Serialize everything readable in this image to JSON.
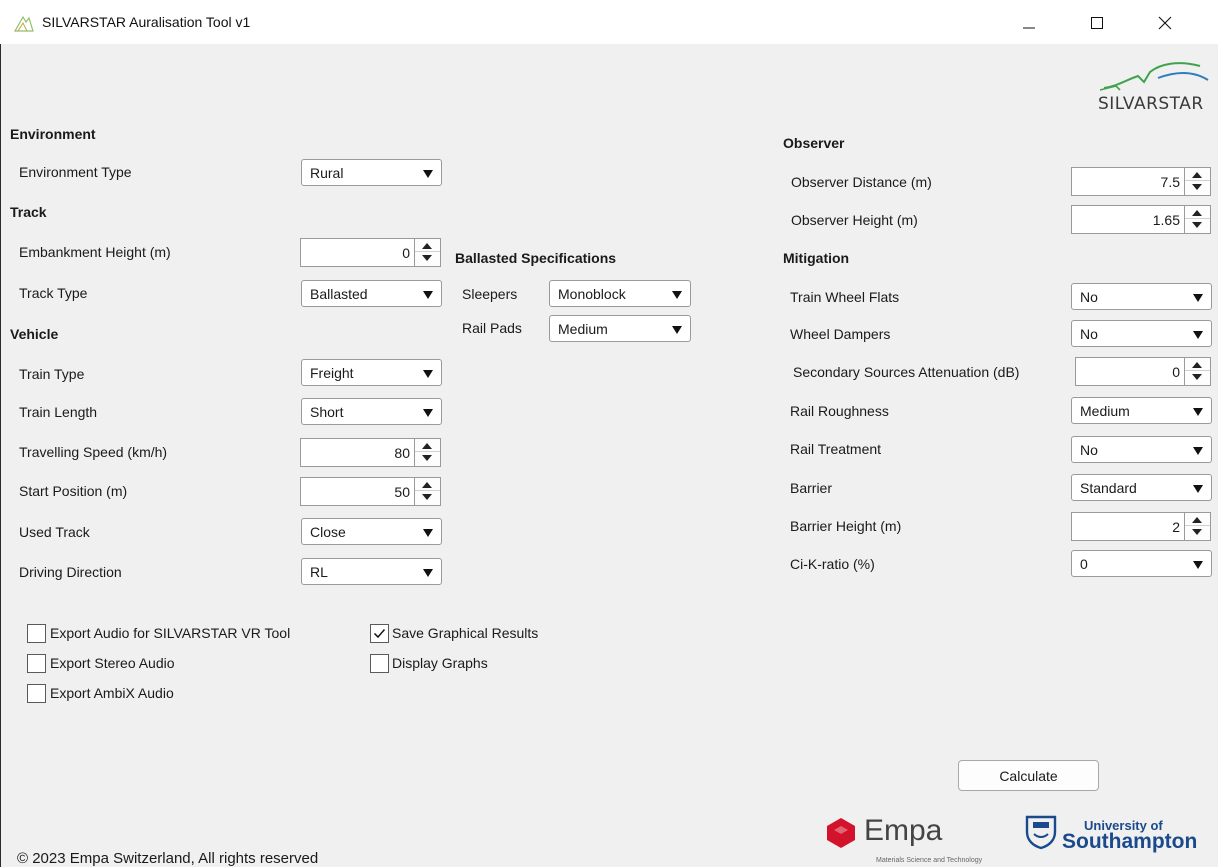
{
  "window": {
    "title": "SILVARSTAR Auralisation Tool v1",
    "minimize_icon": "minimize-icon",
    "maximize_icon": "maximize-icon",
    "close_icon": "close-icon"
  },
  "logos": {
    "silvarstar": "SILVARSTAR",
    "empa": "Empa",
    "empa_sub": "Materials Science and Technology",
    "southampton_top": "University of",
    "southampton_bottom": "Southampton"
  },
  "environment": {
    "heading": "Environment",
    "type_label": "Environment Type",
    "type_value": "Rural"
  },
  "track": {
    "heading": "Track",
    "embankment_label": "Embankment Height (m)",
    "embankment_value": "0",
    "type_label": "Track Type",
    "type_value": "Ballasted"
  },
  "ballasted": {
    "heading": "Ballasted Specifications",
    "sleepers_label": "Sleepers",
    "sleepers_value": "Monoblock",
    "railpads_label": "Rail Pads",
    "railpads_value": "Medium"
  },
  "vehicle": {
    "heading": "Vehicle",
    "train_type_label": "Train Type",
    "train_type_value": "Freight",
    "train_length_label": "Train Length",
    "train_length_value": "Short",
    "speed_label": "Travelling Speed (km/h)",
    "speed_value": "80",
    "start_label": "Start Position (m)",
    "start_value": "50",
    "used_track_label": "Used Track",
    "used_track_value": "Close",
    "direction_label": "Driving Direction",
    "direction_value": "RL"
  },
  "observer": {
    "heading": "Observer",
    "distance_label": "Observer Distance (m)",
    "distance_value": "7.5",
    "height_label": "Observer Height (m)",
    "height_value": "1.65"
  },
  "mitigation": {
    "heading": "Mitigation",
    "wheel_flats_label": "Train Wheel Flats",
    "wheel_flats_value": "No",
    "wheel_dampers_label": "Wheel Dampers",
    "wheel_dampers_value": "No",
    "secondary_label": "Secondary Sources Attenuation (dB)",
    "secondary_value": "0",
    "roughness_label": "Rail Roughness",
    "roughness_value": "Medium",
    "treatment_label": "Rail Treatment",
    "treatment_value": "No",
    "barrier_label": "Barrier",
    "barrier_value": "Standard",
    "barrier_height_label": "Barrier Height (m)",
    "barrier_height_value": "2",
    "cik_label": "Ci-K-ratio (%)",
    "cik_value": "0"
  },
  "options": {
    "export_vr_label": "Export Audio for SILVARSTAR VR Tool",
    "export_vr_checked": false,
    "export_stereo_label": "Export Stereo Audio",
    "export_stereo_checked": false,
    "export_ambix_label": "Export AmbiX Audio",
    "export_ambix_checked": false,
    "save_graphical_label": "Save Graphical Results",
    "save_graphical_checked": true,
    "display_graphs_label": "Display Graphs",
    "display_graphs_checked": false
  },
  "actions": {
    "calculate_label": "Calculate"
  },
  "footer": {
    "copyright": "© 2023 Empa Switzerland, All rights reserved"
  },
  "colors": {
    "window_bg": "#f0f0f0",
    "empa_red": "#d3122b",
    "southampton_blue": "#1b4a8c",
    "silvarstar_green": "#3fa34d",
    "silvarstar_blue": "#2a7fbf"
  }
}
